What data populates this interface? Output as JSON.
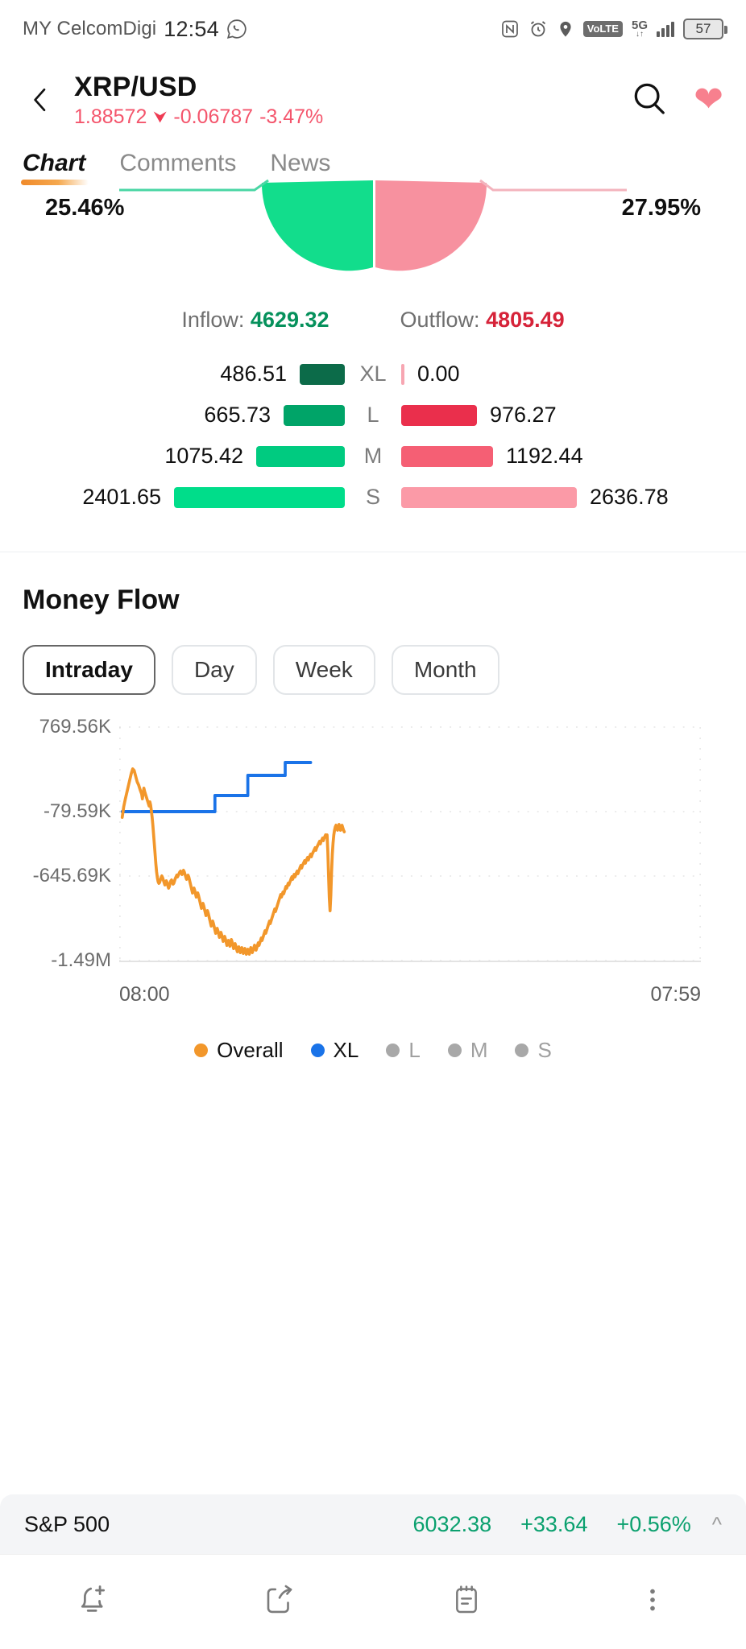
{
  "status_bar": {
    "carrier": "MY CelcomDigi",
    "time": "12:54",
    "whatsapp_icon": "whatsapp-icon",
    "icons": [
      "nfc-icon",
      "alarm-icon",
      "location-icon",
      "volte-icon",
      "signal-5g-icon",
      "battery-icon"
    ],
    "volte_label": "VoLTE",
    "network_label": "5G",
    "network_sub": "↓↑",
    "battery_level": "57"
  },
  "header": {
    "back_icon": "chevron-left-icon",
    "symbol": "XRP/USD",
    "price": "1.88572",
    "direction_icon": "arrow-down-icon",
    "change": "-0.06787",
    "change_percent": "-3.47%",
    "search_icon": "search-icon",
    "favorite_icon": "heart-icon",
    "down_color": "#f4556c"
  },
  "tabs": [
    {
      "label": "Chart",
      "active": true
    },
    {
      "label": "Comments",
      "active": false
    },
    {
      "label": "News",
      "active": false
    }
  ],
  "money_flow_summary": {
    "left_percent": "25.46%",
    "right_percent": "27.95%",
    "inflow_label": "Inflow:",
    "inflow_value": "4629.32",
    "outflow_label": "Outflow:",
    "outflow_value": "4805.49",
    "inflow_color": "#06915c",
    "outflow_color": "#d62339",
    "rows": [
      {
        "tag": "XL",
        "in_value": "486.51",
        "out_value": "0.00",
        "in_width": 56,
        "out_width": 4,
        "in_color": "#0c6b49",
        "out_color": "#f7a6b2"
      },
      {
        "tag": "L",
        "in_value": "665.73",
        "out_value": "976.27",
        "in_width": 76,
        "out_width": 94,
        "in_color": "#00a468",
        "out_color": "#ea2f4c"
      },
      {
        "tag": "M",
        "in_value": "1075.42",
        "out_value": "1192.44",
        "in_width": 110,
        "out_width": 114,
        "in_color": "#00cb80",
        "out_color": "#f55f74"
      },
      {
        "tag": "S",
        "in_value": "2401.65",
        "out_value": "2636.78",
        "in_width": 212,
        "out_width": 218,
        "in_color": "#00dd8a",
        "out_color": "#fb9aa7"
      }
    ]
  },
  "money_flow": {
    "title": "Money Flow",
    "ranges": [
      {
        "label": "Intraday",
        "active": true
      },
      {
        "label": "Day",
        "active": false
      },
      {
        "label": "Week",
        "active": false
      },
      {
        "label": "Month",
        "active": false
      }
    ]
  },
  "chart_data": {
    "type": "line",
    "title": "Money Flow",
    "xlabel": "",
    "ylabel": "",
    "grid": true,
    "legend_position": "bottom",
    "x_tick_labels": [
      "08:00",
      "07:59"
    ],
    "y_tick_labels": [
      "769.56K",
      "-79.59K",
      "-645.69K",
      "-1.49M"
    ],
    "y_tick_values": [
      769560,
      -79590,
      -645690,
      -1490000
    ],
    "ylim": [
      -1490000,
      769560
    ],
    "x": [
      0,
      1,
      2,
      3,
      4,
      5,
      6,
      7,
      8,
      9,
      10,
      11,
      12,
      13,
      14,
      15,
      16,
      17,
      18,
      19,
      20,
      21,
      22,
      23,
      24,
      25,
      26,
      27,
      28,
      29,
      30,
      31,
      32,
      33,
      34,
      35,
      36,
      37,
      38,
      39,
      40,
      41,
      42,
      43,
      44,
      45,
      46,
      47,
      48,
      49,
      50,
      51,
      52,
      53,
      54,
      55,
      56,
      57,
      58,
      59,
      60,
      61,
      62,
      63,
      64,
      65,
      66,
      67,
      68,
      69,
      70,
      71,
      72,
      73,
      74,
      75,
      76,
      77,
      78,
      79,
      80
    ],
    "series": [
      {
        "name": "Overall",
        "color": "#f2972b",
        "active": true,
        "values": [
          -79590,
          -40000,
          120000,
          260000,
          330000,
          300000,
          210000,
          150000,
          60000,
          40000,
          95000,
          60000,
          10000,
          -60000,
          -150000,
          -300000,
          -470000,
          -560000,
          -605000,
          -620000,
          -640000,
          -645690,
          -640000,
          -660000,
          -680000,
          -695000,
          -670000,
          -655000,
          -640000,
          -630000,
          -625000,
          -615000,
          -610000,
          -625000,
          -660000,
          -700000,
          -740000,
          -770000,
          -800000,
          -830000,
          -860000,
          -890000,
          -930000,
          -980000,
          -1030000,
          -1070000,
          -1110000,
          -1150000,
          -1185000,
          -1205000,
          -1230000,
          -1205000,
          -1175000,
          -1195000,
          -1230000,
          -1250000,
          -1210000,
          -1155000,
          -1100000,
          -1055000,
          -1000000,
          -950000,
          -900000,
          -855000,
          -820000,
          -795000,
          -810000,
          -790000,
          -770000,
          -760000,
          -745000,
          -700000,
          -640000,
          -600000,
          -560000,
          -540000,
          -900000,
          -760000,
          -430000,
          -380000,
          -395000
        ]
      },
      {
        "name": "XL",
        "color": "#1a73e8",
        "active": true,
        "step": true,
        "values": [
          -79590,
          -79590,
          -79590,
          -79590,
          -79590,
          -79590,
          -79590,
          -79590,
          -79590,
          -79590,
          -79590,
          -79590,
          -79590,
          -79590,
          -79590,
          -79590,
          -79590,
          -79590,
          -79590,
          -79590,
          -79590,
          -79590,
          -79590,
          -79590,
          -79590,
          -79590,
          -79590,
          -79590,
          -79590,
          -79590,
          -79590,
          -79590,
          -79590,
          -79590,
          -79590,
          -79590,
          -79590,
          -79590,
          -79590,
          -79590,
          -79590,
          -79590,
          -79590,
          -79590,
          -79590,
          -79590,
          -79590,
          60000,
          60000,
          60000,
          60000,
          60000,
          60000,
          60000,
          60000,
          60000,
          180000,
          180000,
          180000,
          180000,
          180000,
          180000,
          180000,
          180000,
          180000,
          180000,
          180000,
          180000,
          180000,
          180000,
          180000,
          180000,
          250000,
          250000,
          320000,
          320000,
          320000,
          320000,
          320000,
          320000,
          320000
        ]
      },
      {
        "name": "L",
        "color": "#a8a8a8",
        "active": false,
        "values": []
      },
      {
        "name": "M",
        "color": "#a8a8a8",
        "active": false,
        "values": []
      },
      {
        "name": "S",
        "color": "#a8a8a8",
        "active": false,
        "values": []
      }
    ]
  },
  "ticker": {
    "name": "S&P 500",
    "value": "6032.38",
    "change": "+33.64",
    "change_percent": "+0.56%",
    "color": "#0aa06e",
    "expand_icon": "chevron-up-icon"
  },
  "bottom_nav": [
    {
      "icon": "add-alert-icon"
    },
    {
      "icon": "share-icon"
    },
    {
      "icon": "notes-icon"
    },
    {
      "icon": "more-vertical-icon"
    }
  ]
}
